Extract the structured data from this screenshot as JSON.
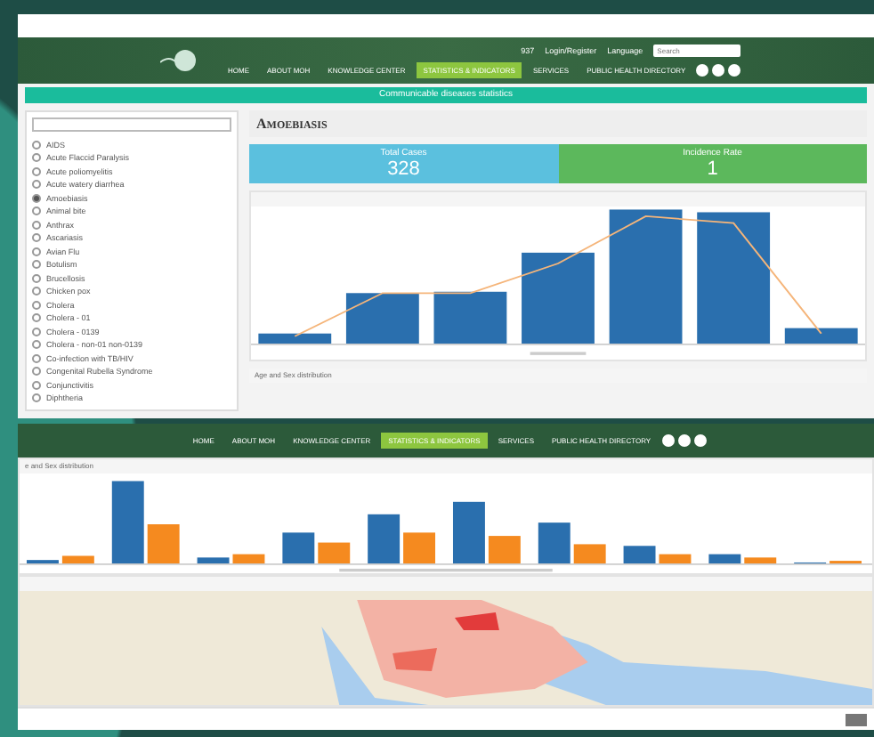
{
  "top_screen": {
    "top_links": [
      "937",
      "Login/Register",
      "Language"
    ],
    "search": {
      "placeholder": "Search"
    },
    "nav": [
      {
        "label": "HOME",
        "selected": false
      },
      {
        "label": "ABOUT MOH",
        "selected": false
      },
      {
        "label": "KNOWLEDGE CENTER",
        "selected": false
      },
      {
        "label": "STATISTICS & INDICATORS",
        "selected": true
      },
      {
        "label": "SERVICES",
        "selected": false
      },
      {
        "label": "PUBLIC HEALTH DIRECTORY",
        "selected": false
      }
    ],
    "banner": "Communicable diseases statistics",
    "diseases": [
      {
        "label": "AIDS",
        "selected": false
      },
      {
        "label": "Acute Flaccid Paralysis",
        "selected": false
      },
      {
        "label": "Acute poliomyelitis",
        "selected": false
      },
      {
        "label": "Acute watery diarrhea",
        "selected": false
      },
      {
        "label": "Amoebiasis",
        "selected": true
      },
      {
        "label": "Animal bite",
        "selected": false
      },
      {
        "label": "Anthrax",
        "selected": false
      },
      {
        "label": "Ascariasis",
        "selected": false
      },
      {
        "label": "Avian Flu",
        "selected": false
      },
      {
        "label": "Botulism",
        "selected": false
      },
      {
        "label": "Brucellosis",
        "selected": false
      },
      {
        "label": "Chicken pox",
        "selected": false
      },
      {
        "label": "Cholera",
        "selected": false
      },
      {
        "label": "Cholera - 01",
        "selected": false
      },
      {
        "label": "Cholera - 0139",
        "selected": false
      },
      {
        "label": "Cholera - non-01 non-0139",
        "selected": false
      },
      {
        "label": "Co-infection with TB/HIV",
        "selected": false
      },
      {
        "label": "Congenital Rubella Syndrome",
        "selected": false
      },
      {
        "label": "Conjunctivitis",
        "selected": false
      },
      {
        "label": "Diphtheria",
        "selected": false
      }
    ],
    "title": "Amoebiasis",
    "stats": [
      {
        "label": "Total Cases",
        "value": "328",
        "color": "#5bc0de"
      },
      {
        "label": "Incidence Rate",
        "value": "1",
        "color": "#5cb85c"
      }
    ],
    "next_panel": "Age and Sex distribution"
  },
  "bottom_screen": {
    "nav": [
      {
        "label": "HOME",
        "selected": false
      },
      {
        "label": "ABOUT MOH",
        "selected": false
      },
      {
        "label": "KNOWLEDGE CENTER",
        "selected": false
      },
      {
        "label": "STATISTICS & INDICATORS",
        "selected": true
      },
      {
        "label": "SERVICES",
        "selected": false
      },
      {
        "label": "PUBLIC HEALTH DIRECTORY",
        "selected": false
      }
    ],
    "chart_heading": "e and Sex distribution"
  }
}
